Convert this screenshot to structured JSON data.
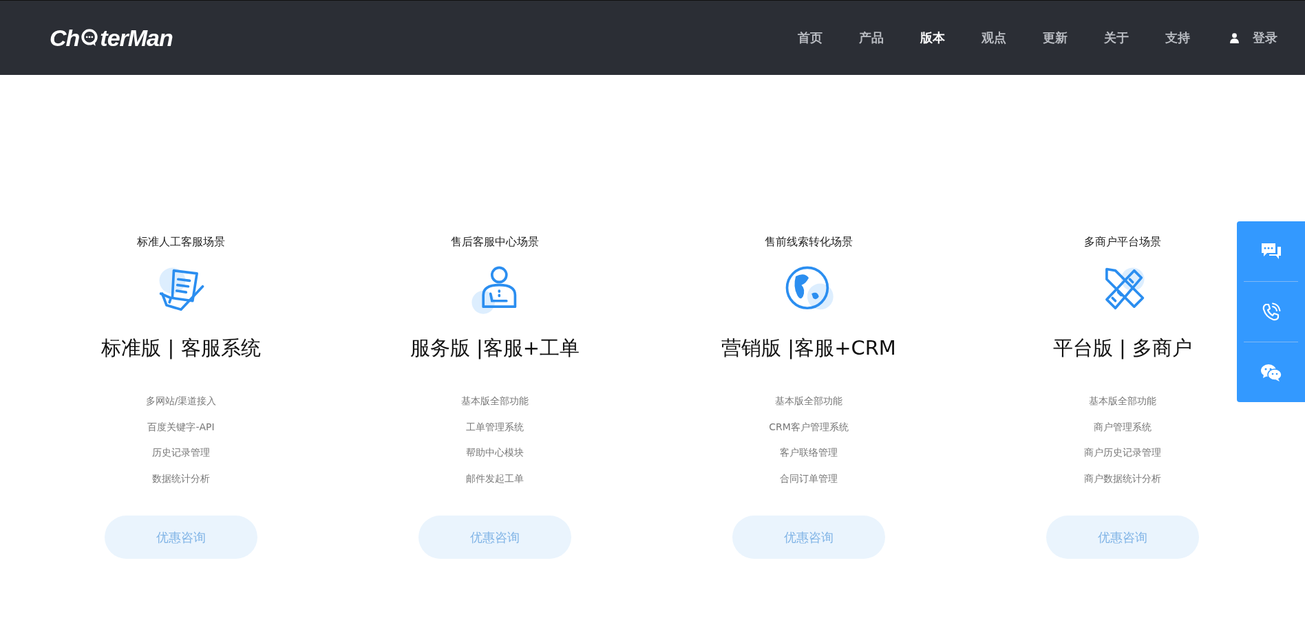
{
  "header": {
    "logo": {
      "before": "Ch",
      "after": "terMan"
    },
    "nav": [
      {
        "label": "首页",
        "selected": false
      },
      {
        "label": "产品",
        "selected": false
      },
      {
        "label": "版本",
        "selected": true
      },
      {
        "label": "观点",
        "selected": false
      },
      {
        "label": "更新",
        "selected": false
      },
      {
        "label": "关于",
        "selected": false
      },
      {
        "label": "支持",
        "selected": false
      }
    ],
    "login": "登录"
  },
  "plans": [
    {
      "kind": "document",
      "scenario": "标准人工客服场景",
      "title": "标准版 | 客服系统",
      "features": [
        "多网站/渠道接入",
        "百度关键字-API",
        "历史记录管理",
        "数据统计分析"
      ],
      "button": "优惠咨询"
    },
    {
      "kind": "agent",
      "scenario": "售后客服中心场景",
      "title": "服务版 |客服+工单",
      "features": [
        "基本版全部功能",
        "工单管理系统",
        "帮助中心模块",
        "邮件发起工单"
      ],
      "button": "优惠咨询"
    },
    {
      "kind": "globe",
      "scenario": "售前线索转化场景",
      "title": "营销版 |客服+CRM",
      "features": [
        "基本版全部功能",
        "CRM客户管理系统",
        "客户联络管理",
        "合同订单管理"
      ],
      "button": "优惠咨询"
    },
    {
      "kind": "tools",
      "scenario": "多商户平台场景",
      "title": "平台版 | 多商户",
      "features": [
        "基本版全部功能",
        "商户管理系统",
        "商户历史记录管理",
        "商户数据统计分析"
      ],
      "button": "优惠咨询"
    }
  ],
  "side_panel": [
    {
      "kind": "chat"
    },
    {
      "kind": "phone"
    },
    {
      "kind": "wechat"
    }
  ]
}
